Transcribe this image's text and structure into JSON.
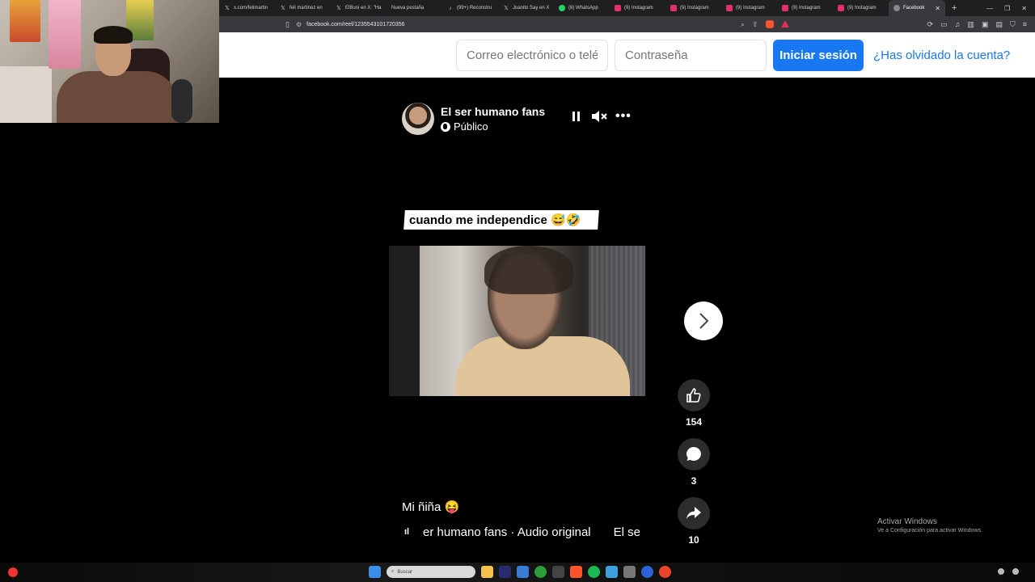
{
  "browser": {
    "tabs": [
      {
        "label": "x.com/felimartin",
        "icon": "x-logo-icon",
        "color": "#ffffff"
      },
      {
        "label": "feli martinez en",
        "icon": "x-logo-icon",
        "color": "#ffffff"
      },
      {
        "label": "ElBuni en X: \"Ha",
        "icon": "x-logo-icon",
        "color": "#ffffff"
      },
      {
        "label": "Nueva pestaña",
        "icon": "",
        "color": "#ffffff"
      },
      {
        "label": "(99+) Reconstru",
        "icon": "tiktok-icon",
        "color": "#ffffff"
      },
      {
        "label": "Juanito Say en X",
        "icon": "x-logo-icon",
        "color": "#ffffff"
      },
      {
        "label": "(8) WhatsApp",
        "icon": "whatsapp-icon",
        "color": "#25d366"
      },
      {
        "label": "(9) Instagram",
        "icon": "instagram-icon",
        "color": "#e1306c"
      },
      {
        "label": "(9) Instagram",
        "icon": "instagram-icon",
        "color": "#e1306c"
      },
      {
        "label": "(9) Instagram",
        "icon": "instagram-icon",
        "color": "#e1306c"
      },
      {
        "label": "(9) Instagram",
        "icon": "instagram-icon",
        "color": "#e1306c"
      },
      {
        "label": "(9) Instagram",
        "icon": "instagram-icon",
        "color": "#e1306c"
      }
    ],
    "active_tab": {
      "label": "Facebook",
      "icon": "facebook-icon"
    },
    "url": "facebook.com/reel/1235543101720356"
  },
  "login": {
    "email_placeholder": "Correo electrónico o teléfono",
    "password_placeholder": "Contraseña",
    "login_button": "Iniciar sesión",
    "forgot_link": "¿Has olvidado la cuenta?"
  },
  "reel": {
    "author": "El ser humano fans",
    "privacy": "Público",
    "caption_overlay": "cuando me independice 😅🤣",
    "description": "Mi ñiña 😝",
    "audio_text": "er humano fans · Audio original",
    "audio_text_2": "El se",
    "likes": "154",
    "comments": "3",
    "shares": "10"
  },
  "watermark": {
    "line1": "Activar Windows",
    "line2": "Ve a Configuración para activar Windows."
  },
  "taskbar": {
    "search_placeholder": "Buscar"
  },
  "colors": {
    "accent": "#1877f2",
    "page_background": "#000000"
  }
}
